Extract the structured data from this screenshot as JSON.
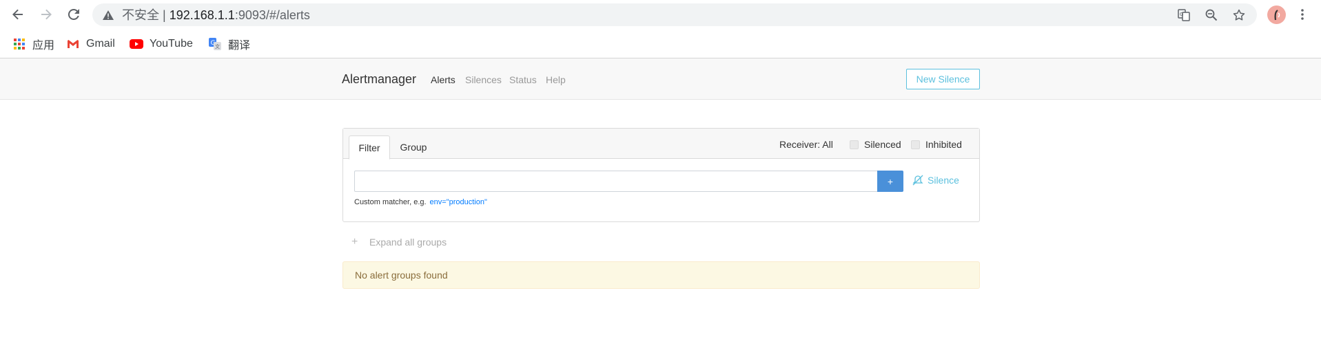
{
  "browser": {
    "url_insecure_label": "不安全",
    "url_separator": "|",
    "url_host": "192.168.1.1",
    "url_path": ":9093/#/alerts",
    "icons": [
      "back-icon",
      "forward-icon",
      "reload-icon",
      "warning-icon",
      "translate-icon",
      "zoom-icon",
      "star-icon",
      "profile-avatar",
      "menu-icon"
    ]
  },
  "bookmarks": [
    {
      "label": "应用",
      "icon": "apps-grid-icon"
    },
    {
      "label": "Gmail",
      "icon": "gmail-icon"
    },
    {
      "label": "YouTube",
      "icon": "youtube-icon"
    },
    {
      "label": "翻译",
      "icon": "google-translate-icon"
    }
  ],
  "navbar": {
    "brand": "Alertmanager",
    "links": [
      "Alerts",
      "Silences",
      "Status",
      "Help"
    ],
    "active": "Alerts",
    "new_silence_label": "New Silence"
  },
  "filter": {
    "tabs": [
      "Filter",
      "Group"
    ],
    "active_tab": "Filter",
    "receiver_label": "Receiver: All",
    "silenced_label": "Silenced",
    "inhibited_label": "Inhibited",
    "matcher_value": "",
    "plus_label": "+",
    "silence_label": "Silence",
    "hint_text": "Custom matcher, e.g.",
    "hint_example": "env=\"production\""
  },
  "expand_label": "Expand all groups",
  "empty_message": "No alert groups found",
  "colors": {
    "accent": "#5bc0de",
    "primary_button": "#4a90d9",
    "warning_bg": "#fcf8e3",
    "warning_text": "#8a6d3b",
    "youtube_red": "#ff0000",
    "gmail_red": "#ea4335"
  }
}
